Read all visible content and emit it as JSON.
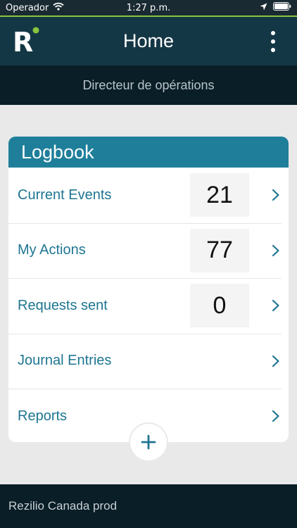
{
  "status_bar": {
    "carrier": "Operador",
    "time": "1:27 p.m."
  },
  "header": {
    "title": "Home",
    "logo_letter": "R"
  },
  "subheader": {
    "role": "Directeur de opérations"
  },
  "logbook": {
    "title": "Logbook",
    "items": [
      {
        "label": "Current Events",
        "count": "21"
      },
      {
        "label": "My Actions",
        "count": "77"
      },
      {
        "label": "Requests sent",
        "count": "0"
      },
      {
        "label": "Journal Entries",
        "count": null
      },
      {
        "label": "Reports",
        "count": null
      }
    ]
  },
  "footer": {
    "environment": "Rezilio Canada prod"
  },
  "colors": {
    "header_bg": "#143745",
    "accent_green": "#8bc53f",
    "card_header": "#1f7f9a",
    "link_text": "#1e7591"
  },
  "icons": {
    "wifi": "wifi-icon",
    "location": "location-arrow-icon",
    "battery": "battery-icon",
    "menu": "more-vertical-icon",
    "chevron": "chevron-right-icon",
    "add": "plus-icon"
  }
}
